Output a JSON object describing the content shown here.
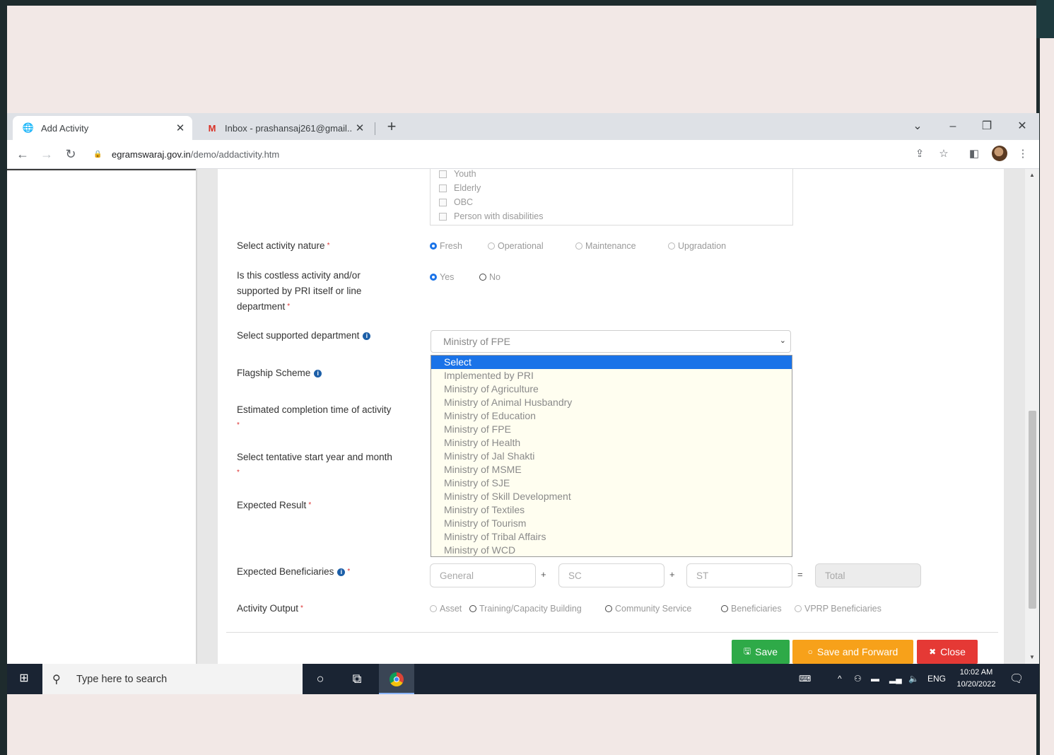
{
  "browser": {
    "tabs": [
      {
        "title": "Add Activity",
        "favicon": "globe-icon",
        "active": true
      },
      {
        "title": "Inbox - prashansaj261@gmail...",
        "favicon": "gmail-icon",
        "active": false
      }
    ],
    "address": {
      "host": "egramswaraj.gov.in",
      "path": "/demo/addactivity.htm"
    }
  },
  "form": {
    "beneficiary_groups": [
      "Youth",
      "Elderly",
      "OBC",
      "Person with disabilities"
    ],
    "activity_nature": {
      "label": "Select activity nature",
      "options": [
        "Fresh",
        "Operational",
        "Maintenance",
        "Upgradation"
      ],
      "selected": "Fresh"
    },
    "costless": {
      "label_lines": [
        "Is this costless activity and/or",
        "supported by PRI itself or line",
        "department"
      ],
      "options": [
        "Yes",
        "No"
      ],
      "selected": "Yes"
    },
    "supported_department": {
      "label": "Select supported department",
      "value": "Ministry of FPE",
      "options": [
        "Select",
        "Implemented by PRI",
        "Ministry of Agriculture",
        "Ministry of Animal Husbandry",
        "Ministry of Education",
        "Ministry of FPE",
        "Ministry of Health",
        "Ministry of Jal Shakti",
        "Ministry of MSME",
        "Ministry of SJE",
        "Ministry of Skill Development",
        "Ministry of Textiles",
        "Ministry of Tourism",
        "Ministry of Tribal Affairs",
        "Ministry of WCD"
      ],
      "highlighted": "Select"
    },
    "flagship_scheme": {
      "label": "Flagship Scheme"
    },
    "completion_time": {
      "label": "Estimated completion time of activity"
    },
    "start_year_month": {
      "label": "Select tentative start year and month"
    },
    "expected_result": {
      "label": "Expected Result"
    },
    "expected_beneficiaries": {
      "label": "Expected Beneficiaries",
      "placeholders": [
        "General",
        "SC",
        "ST",
        "Total"
      ],
      "operators": [
        "+",
        "+",
        "="
      ]
    },
    "activity_output": {
      "label": "Activity Output",
      "options": [
        "Asset",
        "Training/Capacity Building",
        "Community Service",
        "Beneficiaries",
        "VPRP Beneficiaries"
      ]
    },
    "required_mark": "*",
    "info_icon_glyph": "i"
  },
  "buttons": {
    "save": "Save",
    "save_forward": "Save and Forward",
    "close": "Close"
  },
  "taskbar": {
    "search_placeholder": "Type here to search",
    "language": "ENG",
    "time": "10:02 AM",
    "date": "10/20/2022"
  },
  "colors": {
    "save": "#2eaa48",
    "save_forward": "#f7a11a",
    "close": "#e53935",
    "selection": "#1a73e8",
    "taskbar": "#1a2433"
  }
}
